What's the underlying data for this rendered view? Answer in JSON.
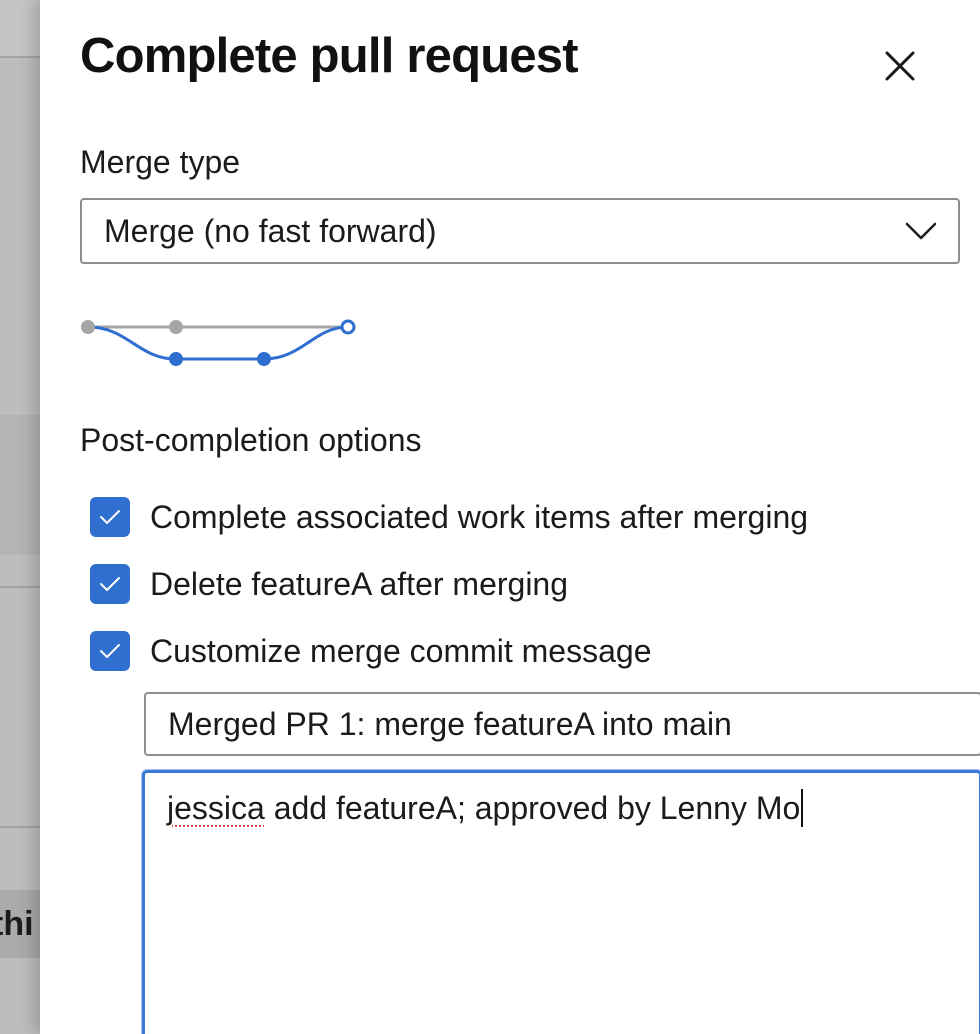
{
  "background": {
    "fragment_text": "thi"
  },
  "dialog": {
    "title": "Complete pull request",
    "close_icon": "close-icon"
  },
  "merge_type": {
    "label": "Merge type",
    "selected": "Merge (no fast forward)",
    "icon": "chevron-down-icon"
  },
  "post_completion": {
    "label": "Post-completion options",
    "options": [
      {
        "label": "Complete associated work items after merging",
        "checked": true
      },
      {
        "label": "Delete featureA after merging",
        "checked": true
      },
      {
        "label": "Customize merge commit message",
        "checked": true
      }
    ]
  },
  "commit_message": {
    "title_value": "Merged PR 1: merge featureA into main",
    "body_misspelled_word": "jessica",
    "body_rest": " add featureA; approved by Lenny Mo"
  },
  "colors": {
    "accent": "#2f6fcf",
    "focus_border": "#3b78d8",
    "graph_gray": "#a6a6a6"
  }
}
